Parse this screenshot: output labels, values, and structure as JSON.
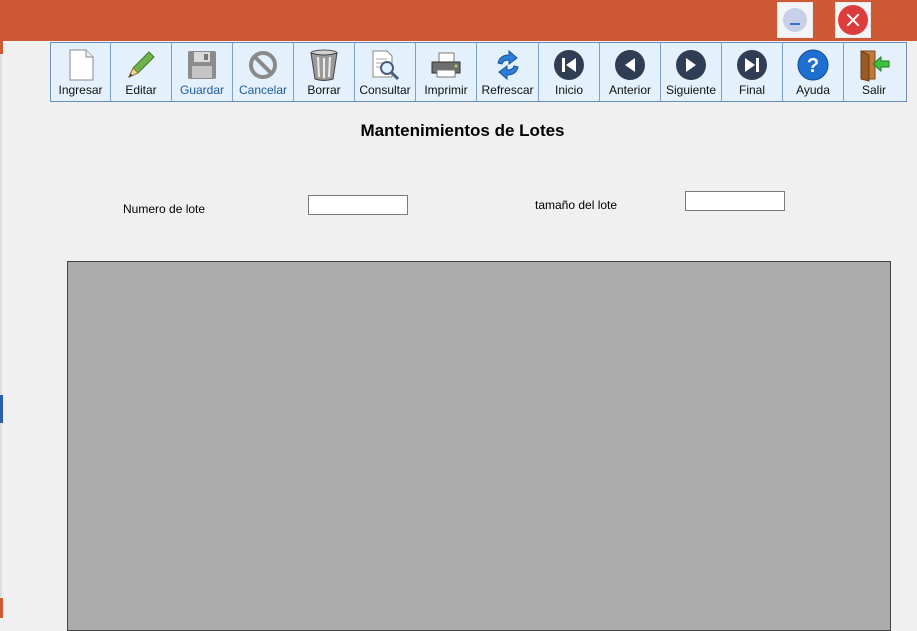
{
  "window": {
    "minimize_icon": "minimize-icon",
    "close_icon": "close-icon",
    "titlebar_color": "#cd5a34"
  },
  "toolbar": {
    "buttons": [
      {
        "label": "Ingresar",
        "icon": "new-document-icon"
      },
      {
        "label": "Editar",
        "icon": "pencil-icon"
      },
      {
        "label": "Guardar",
        "icon": "floppy-disk-icon",
        "state": "disabled"
      },
      {
        "label": "Cancelar",
        "icon": "cancel-icon",
        "state": "disabled"
      },
      {
        "label": "Borrar",
        "icon": "trash-can-icon"
      },
      {
        "label": "Consultar",
        "icon": "search-document-icon"
      },
      {
        "label": "Imprimir",
        "icon": "printer-icon"
      },
      {
        "label": "Refrescar",
        "icon": "refresh-icon"
      },
      {
        "label": "Inicio",
        "icon": "first-record-icon"
      },
      {
        "label": "Anterior",
        "icon": "previous-record-icon"
      },
      {
        "label": "Siguiente",
        "icon": "next-record-icon"
      },
      {
        "label": "Final",
        "icon": "last-record-icon"
      },
      {
        "label": "Ayuda",
        "icon": "help-icon"
      },
      {
        "label": "Salir",
        "icon": "exit-door-icon"
      }
    ]
  },
  "form": {
    "title": "Mantenimientos de Lotes",
    "lote_label": "Numero de lote",
    "lote_value": "",
    "tamano_label": "tamaño del lote",
    "tamano_value": ""
  }
}
